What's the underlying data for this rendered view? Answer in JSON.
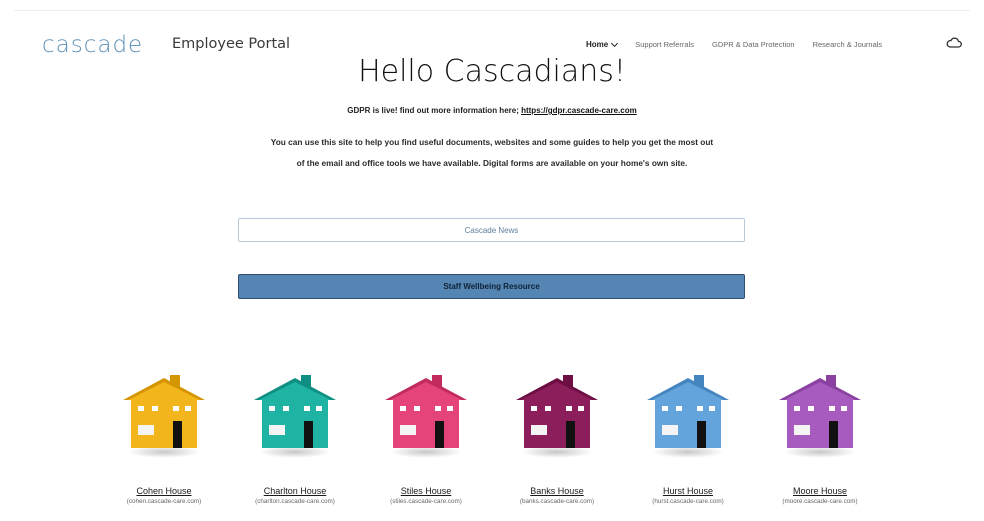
{
  "header": {
    "logo": "cascade",
    "portal_title": "Employee Portal",
    "nav": [
      {
        "label": "Home"
      },
      {
        "label": "Support Referrals"
      },
      {
        "label": "GDPR & Data Protection"
      },
      {
        "label": "Research & Journals"
      }
    ],
    "cloud_icon": "cloud-icon"
  },
  "main": {
    "title": "Hello Cascadians!",
    "gdpr_text": "GDPR is live! find out more information here; ",
    "gdpr_link": "https://gdpr.cascade-care.com",
    "intro": "You can use this site to help you find useful documents, websites and some guides to help you get the most out of the email and office tools we have available. Digital forms are available on your home's own site.",
    "news_button": "Cascade News",
    "wellbeing_button": "Staff Wellbeing Resource"
  },
  "houses": [
    {
      "name": "Cohen House",
      "url": "(cohen.cascade-care.com)",
      "color": "#f2b51c",
      "dark": "#d49500"
    },
    {
      "name": "Charlton House",
      "url": "(charlton.cascade-care.com)",
      "color": "#1fb3a3",
      "dark": "#0f8f82"
    },
    {
      "name": "Stiles House",
      "url": "(stiles.cascade-care.com)",
      "color": "#e4447a",
      "dark": "#c02a5d"
    },
    {
      "name": "Banks House",
      "url": "(banks.cascade-care.com)",
      "color": "#8c1e5c",
      "dark": "#6d0f43"
    },
    {
      "name": "Hurst House",
      "url": "(hurst.cascade-care.com)",
      "color": "#64a4dd",
      "dark": "#4585bf"
    },
    {
      "name": "Moore House",
      "url": "(moore.cascade-care.com)",
      "color": "#a75bbf",
      "dark": "#8a41a2"
    }
  ]
}
